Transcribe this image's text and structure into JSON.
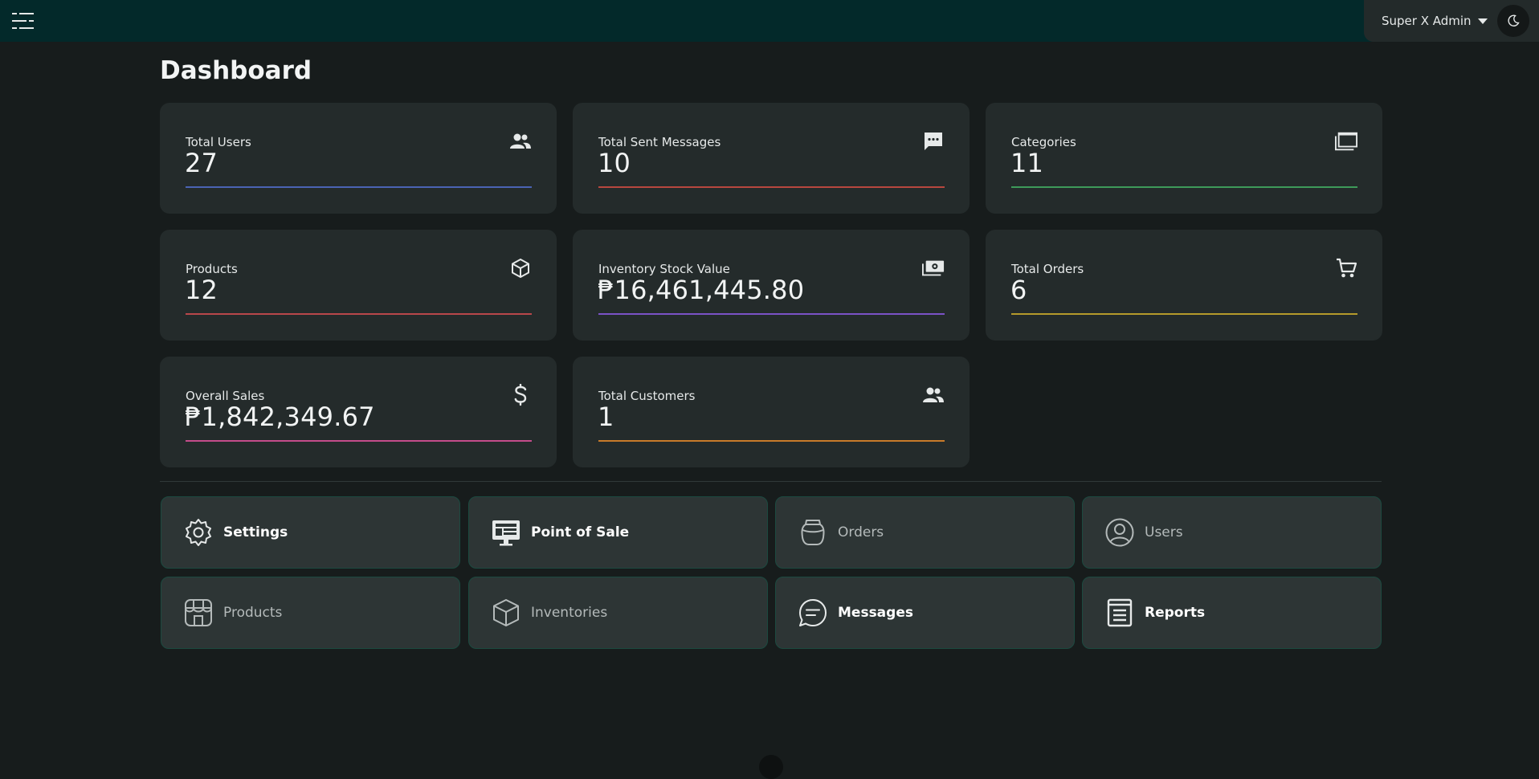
{
  "header": {
    "user_name": "Super X Admin"
  },
  "page": {
    "title": "Dashboard"
  },
  "stats": [
    {
      "label": "Total Users",
      "value": "27",
      "icon": "users-icon",
      "color": "#4a63b3"
    },
    {
      "label": "Total Sent Messages",
      "value": "10",
      "icon": "chat-icon",
      "color": "#b8473f"
    },
    {
      "label": "Categories",
      "value": "11",
      "icon": "folders-icon",
      "color": "#3e9a5a"
    },
    {
      "label": "Products",
      "value": "12",
      "icon": "cube-icon",
      "color": "#b8474a"
    },
    {
      "label": "Inventory Stock Value",
      "value": "₱16,461,445.80",
      "icon": "money-icon",
      "color": "#7b52c7"
    },
    {
      "label": "Total Orders",
      "value": "6",
      "icon": "cart-icon",
      "color": "#b59a2b"
    },
    {
      "label": "Overall Sales",
      "value": "₱1,842,349.67",
      "icon": "dollar-icon",
      "color": "#c44c8a"
    },
    {
      "label": "Total Customers",
      "value": "1",
      "icon": "users-icon",
      "color": "#c87a2a"
    }
  ],
  "nav": [
    {
      "label": "Settings",
      "icon": "gear-icon"
    },
    {
      "label": "Point of Sale",
      "icon": "pos-terminal-icon"
    },
    {
      "label": "Orders",
      "icon": "jar-icon"
    },
    {
      "label": "Users",
      "icon": "user-circle-icon"
    },
    {
      "label": "Products",
      "icon": "storefront-icon"
    },
    {
      "label": "Inventories",
      "icon": "box-icon"
    },
    {
      "label": "Messages",
      "icon": "message-bubble-icon"
    },
    {
      "label": "Reports",
      "icon": "report-icon"
    }
  ]
}
